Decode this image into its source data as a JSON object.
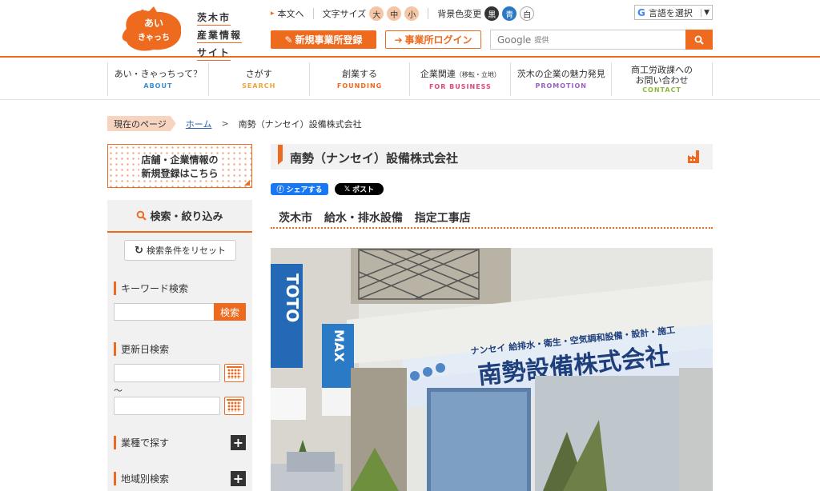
{
  "logo": {
    "mascot_text_1": "あい",
    "mascot_text_2": "きゃっち",
    "lines": [
      "茨木市",
      "産業情報",
      "サイト"
    ]
  },
  "util": {
    "plain_text": "本文へ",
    "font_size_label": "文字サイズ",
    "font_sizes": [
      "大",
      "中",
      "小"
    ],
    "bg_label": "背景色変更",
    "bg_options": [
      "黒",
      "青",
      "白"
    ],
    "lang_label": "言語を選択"
  },
  "header": {
    "register_btn": "新規事業所登録",
    "login_btn": "事業所ログイン",
    "search_placeholder": "Google",
    "search_sub": "提供"
  },
  "nav": [
    {
      "jp": "あい・きゃっちって？",
      "en": "ABOUT",
      "color": "#3a8fd1"
    },
    {
      "jp": "さがす",
      "en": "SEARCH",
      "color": "#f0a23b"
    },
    {
      "jp": "創業する",
      "en": "FOUNDING",
      "color": "#ee6a1f"
    },
    {
      "jp": "企業関連",
      "jp_small": "（移転・立地）",
      "en": "FOR BUSINESS",
      "color": "#e0457b"
    },
    {
      "jp": "茨木の企業の魅力発見",
      "en": "PROMOTION",
      "color": "#9a5fc2"
    },
    {
      "jp": "商工労政課への",
      "jp2": "お問い合わせ",
      "en": "CONTACT",
      "color": "#8dbb36"
    }
  ],
  "breadcrumb": {
    "here": "現在のページ",
    "home": "ホーム",
    "sep": ">",
    "current": "南勢（ナンセイ）設備株式会社"
  },
  "sidebar": {
    "banner_line1": "店舗・企業情報の",
    "banner_line2": "新規登録はこちら",
    "search_head": "検索・絞り込み",
    "reset": "検索条件をリセット",
    "keyword_title": "キーワード検索",
    "keyword_btn": "検索",
    "date_title": "更新日検索",
    "tilde": "〜",
    "industry_title": "業種で探す",
    "area_title": "地域別検索"
  },
  "main": {
    "title": "南勢（ナンセイ）設備株式会社",
    "fb_share": "シェアする",
    "x_post": "ポスト",
    "subtitle": "茨木市 給水・排水設備 指定工事店"
  },
  "photo": {
    "sign_main": "南勢設備株式会社",
    "sign_sub": "ナンセイ 給排水・衛生・空気調和設備・設計・施工",
    "toto": "TOTO",
    "max": "MAX"
  },
  "colors": {
    "accent": "#ee6a1f",
    "link": "#2a62b8"
  }
}
